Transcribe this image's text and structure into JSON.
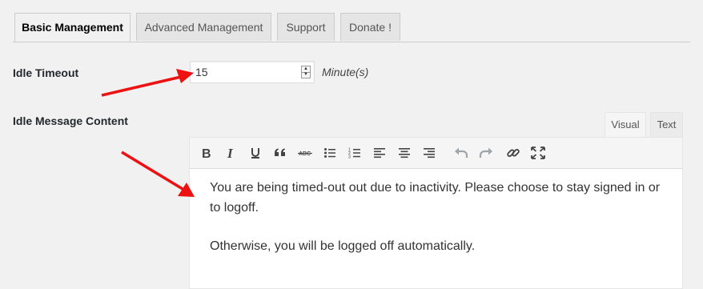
{
  "tabs": [
    {
      "label": "Basic Management",
      "active": true
    },
    {
      "label": "Advanced Management",
      "active": false
    },
    {
      "label": "Support",
      "active": false
    },
    {
      "label": "Donate !",
      "active": false
    }
  ],
  "idle_timeout": {
    "label": "Idle Timeout",
    "value": "15",
    "units": "Minute(s)"
  },
  "idle_message": {
    "label": "Idle Message Content",
    "editor_tabs": [
      {
        "label": "Visual",
        "active": true
      },
      {
        "label": "Text",
        "active": false
      }
    ],
    "toolbar_icons": [
      "bold-icon",
      "italic-icon",
      "underline-icon",
      "blockquote-icon",
      "strikethrough-icon",
      "bullet-list-icon",
      "numbered-list-icon",
      "align-left-icon",
      "align-center-icon",
      "align-right-icon",
      "undo-icon",
      "redo-icon",
      "link-icon",
      "fullscreen-icon"
    ],
    "paragraphs": [
      "You are being timed-out out due to inactivity. Please choose to stay signed in or to logoff.",
      "Otherwise, you will be logged off automatically."
    ]
  },
  "colors": {
    "background": "#f1f1f1",
    "annotation_arrow": "#ee1111",
    "icon": "#444444",
    "icon_disabled": "#a0a5aa"
  }
}
